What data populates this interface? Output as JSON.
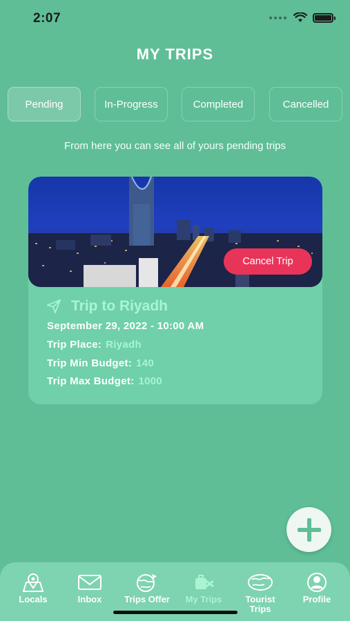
{
  "status_bar": {
    "time": "2:07"
  },
  "header": {
    "title": "MY TRIPS"
  },
  "tabs": [
    {
      "label": "Pending",
      "active": true
    },
    {
      "label": "In-Progress",
      "active": false
    },
    {
      "label": "Completed",
      "active": false
    },
    {
      "label": "Cancelled",
      "active": false
    }
  ],
  "subtitle": "From here you can see all of yours pending trips",
  "trip": {
    "image_icon": "city-skyline-image",
    "cancel_label": "Cancel Trip",
    "title": "Trip to Riyadh",
    "datetime": "September 29, 2022 - 10:00 AM",
    "place_label": "Trip Place:",
    "place_value": "Riyadh",
    "min_budget_label": "Trip Min Budget:",
    "min_budget_value": "140",
    "max_budget_label": "Trip Max Budget:",
    "max_budget_value": "1000"
  },
  "fab": {
    "icon": "plus-icon"
  },
  "bottom_nav": [
    {
      "label": "Locals",
      "icon": "map-pin-icon",
      "active": false
    },
    {
      "label": "Inbox",
      "icon": "envelope-icon",
      "active": false
    },
    {
      "label": "Trips Offer",
      "icon": "globe-icon",
      "active": false
    },
    {
      "label": "My Trips",
      "icon": "luggage-icon",
      "active": true
    },
    {
      "label": "Tourist Trips",
      "icon": "world-icon",
      "active": false
    },
    {
      "label": "Profile",
      "icon": "user-icon",
      "active": false
    }
  ],
  "colors": {
    "background": "#5fbe96",
    "card": "#6fd0a9",
    "accent_text": "#a9f5d2",
    "cancel_button": "#e9345a",
    "nav_bar": "#7ed3b0"
  }
}
